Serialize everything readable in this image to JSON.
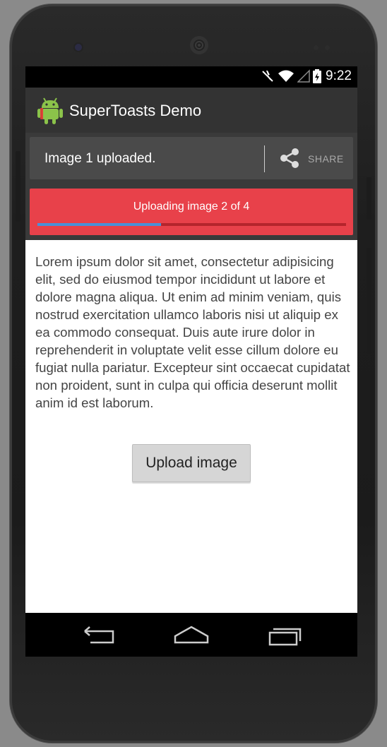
{
  "status_bar": {
    "time": "9:22",
    "icons": [
      "notification-icon",
      "wifi-icon",
      "signal-icon",
      "battery-icon"
    ]
  },
  "action_bar": {
    "title": "SuperToasts Demo",
    "icon": "android-robot-icon"
  },
  "toast_share": {
    "message": "Image 1 uploaded.",
    "button_label": "SHARE",
    "button_icon": "share-icon"
  },
  "toast_progress": {
    "message": "Uploading image 2 of 4",
    "progress": 0.4,
    "color": "#e8414a",
    "bar_color": "#4a90d9"
  },
  "body_text": "Lorem ipsum dolor sit amet, consectetur adipisicing elit, sed do eiusmod tempor incididunt ut labore et dolore magna aliqua. Ut enim ad minim veniam, quis nostrud exercitation ullamco laboris nisi ut aliquip ex ea commodo consequat. Duis aute irure dolor in reprehenderit in voluptate velit esse cillum dolore eu fugiat nulla pariatur. Excepteur sint occaecat cupidatat non proident, sunt in culpa qui officia deserunt mollit anim id est laborum.",
  "upload_button": {
    "label": "Upload image"
  },
  "nav_bar": {
    "buttons": [
      "back-icon",
      "home-icon",
      "recent-apps-icon"
    ]
  }
}
